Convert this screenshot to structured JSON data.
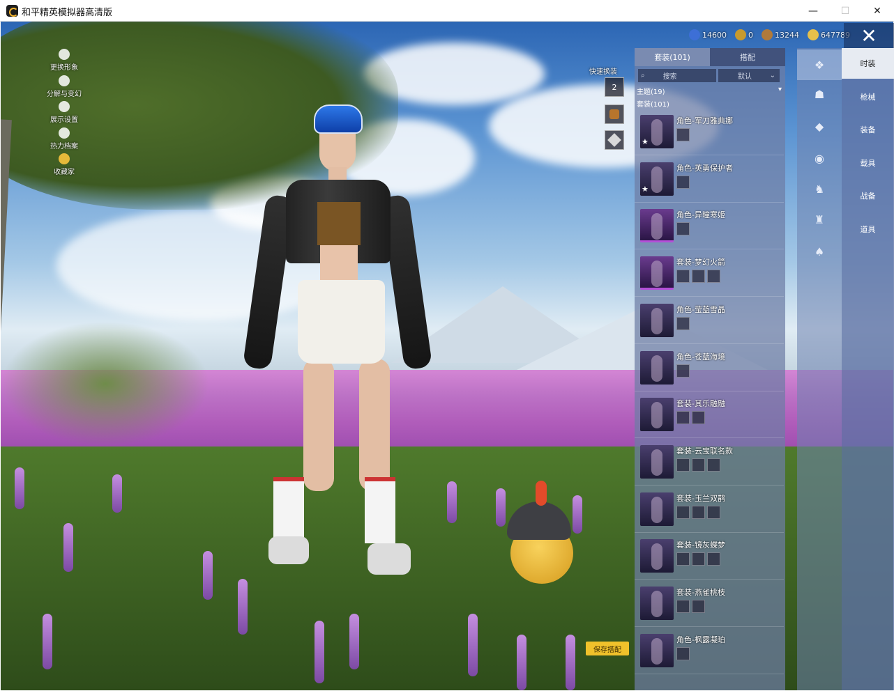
{
  "window": {
    "title": "和平精英模拟器高清版",
    "minimize": "—",
    "maximize": "☐",
    "close": "✕"
  },
  "left_menu": [
    {
      "label": "更换形象",
      "icon": "person-icon"
    },
    {
      "label": "分解与变幻",
      "icon": "puzzle-icon"
    },
    {
      "label": "展示设置",
      "icon": "eye-icon"
    },
    {
      "label": "热力档案",
      "icon": "flame-icon"
    },
    {
      "label": "收藏家",
      "icon": "crown-icon"
    }
  ],
  "currencies": [
    {
      "value": "14600",
      "icon": "coin-blue-icon",
      "color": "#3d6fd6"
    },
    {
      "value": "0",
      "icon": "coin-gold-a-icon",
      "color": "#c89a2e"
    },
    {
      "value": "13244",
      "icon": "coin-bronze-icon",
      "color": "#b07a3a"
    },
    {
      "value": "647789",
      "icon": "coin-gold-icon",
      "color": "#e6c04a"
    }
  ],
  "quick_change": {
    "label": "快速换装",
    "slot_number": "2"
  },
  "panel": {
    "tabs": [
      {
        "label": "套装(101)",
        "active": true
      },
      {
        "label": "搭配",
        "active": false
      }
    ],
    "search_placeholder": "搜索",
    "sort_value": "默认",
    "theme_label": "主题(19)",
    "suit_label": "套装(101)",
    "items": [
      {
        "title": "角色-军刀雅典娜",
        "subs": 1,
        "star": true,
        "rarity": "dark"
      },
      {
        "title": "角色-英勇保护者",
        "subs": 1,
        "star": true,
        "rarity": "dark"
      },
      {
        "title": "角色-异瞳寒姬",
        "subs": 1,
        "star": false,
        "rarity": "purple"
      },
      {
        "title": "套装-梦幻火箭",
        "subs": 3,
        "star": false,
        "rarity": "purple"
      },
      {
        "title": "角色-莹蓝雪晶",
        "subs": 1,
        "star": false,
        "rarity": "dark"
      },
      {
        "title": "角色-苍蓝海境",
        "subs": 1,
        "star": false,
        "rarity": "dark"
      },
      {
        "title": "套装-其乐融融",
        "subs": 2,
        "star": false,
        "rarity": "dark"
      },
      {
        "title": "套装-云宝联名款",
        "subs": 3,
        "star": false,
        "rarity": "dark"
      },
      {
        "title": "套装-玉兰双鹊",
        "subs": 3,
        "star": false,
        "rarity": "dark"
      },
      {
        "title": "套装-镜灰蝶梦",
        "subs": 3,
        "star": false,
        "rarity": "dark"
      },
      {
        "title": "套装-燕雀桃枝",
        "subs": 2,
        "star": false,
        "rarity": "dark"
      },
      {
        "title": "角色-枫露凝珀",
        "subs": 1,
        "star": false,
        "rarity": "dark"
      }
    ]
  },
  "categories": [
    "outfit-icon",
    "head-icon",
    "hat-icon",
    "mask-icon",
    "jacket-icon",
    "pants-icon",
    "shoes-icon"
  ],
  "right_nav": [
    {
      "label": "时装",
      "active": true
    },
    {
      "label": "枪械",
      "active": false
    },
    {
      "label": "装备",
      "active": false
    },
    {
      "label": "载具",
      "active": false
    },
    {
      "label": "战备",
      "active": false
    },
    {
      "label": "道具",
      "active": false
    }
  ],
  "save_button": "保存搭配",
  "close_overlay": "✕"
}
